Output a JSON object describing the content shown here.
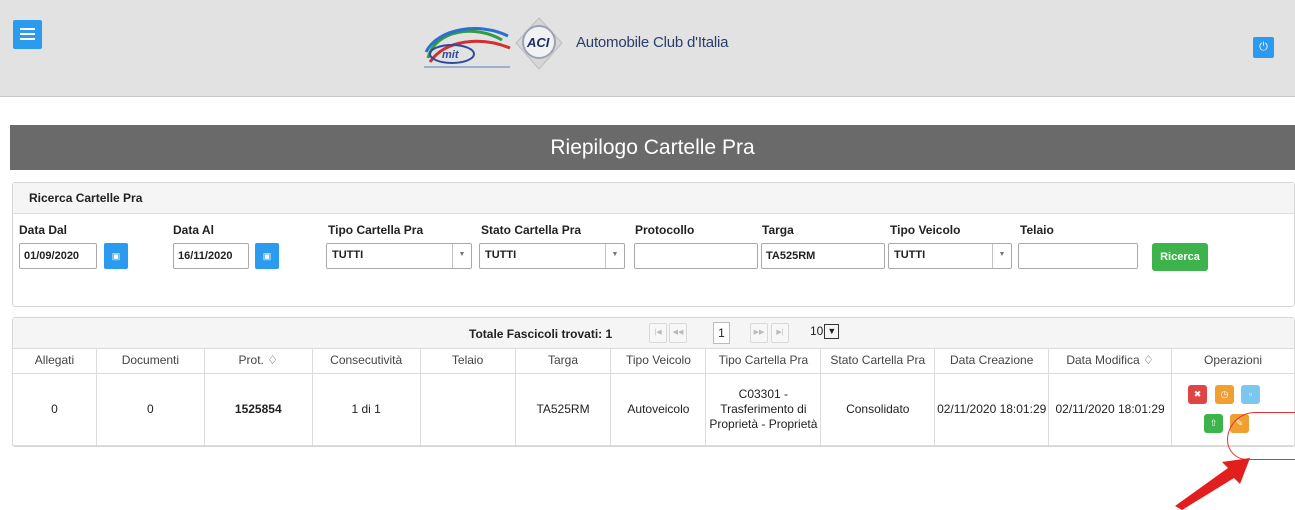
{
  "header": {
    "title": "Automobile Club d'Italia",
    "menu_icon": "hamburger-menu-icon",
    "power_icon": "power-icon",
    "mit_logo": "mit-logo",
    "aci_logo": "aci-logo",
    "brand_color": "#2b9bf0"
  },
  "page": {
    "title": "Riepilogo Cartelle Pra"
  },
  "search": {
    "heading": "Ricerca Cartelle Pra",
    "data_dal_label": "Data Dal",
    "data_dal_value": "01/09/2020",
    "data_al_label": "Data Al",
    "data_al_value": "16/11/2020",
    "tipo_cartella_label": "Tipo Cartella Pra",
    "tipo_cartella_value": "TUTTI",
    "stato_cartella_label": "Stato Cartella Pra",
    "stato_cartella_value": "TUTTI",
    "protocollo_label": "Protocollo",
    "protocollo_value": "",
    "targa_label": "Targa",
    "targa_value": "TA525RM",
    "tipo_veicolo_label": "Tipo Veicolo",
    "tipo_veicolo_value": "TUTTI",
    "telaio_label": "Telaio",
    "telaio_value": "",
    "ricerca_label": "Ricerca",
    "ricerca_color": "#3cb44b"
  },
  "results": {
    "total_label": "Totale Fascicoli trovati: 1",
    "current_page": "1",
    "per_page": "10",
    "columns": [
      "Allegati",
      "Documenti",
      "Prot. ♢",
      "Consecutività",
      "Telaio",
      "Targa",
      "Tipo Veicolo",
      "Tipo Cartella Pra",
      "Stato Cartella Pra",
      "Data Creazione",
      "Data Modifica ♢",
      "Operazioni"
    ],
    "rows": [
      {
        "allegati": "0",
        "documenti": "0",
        "prot": "1525854",
        "consecutivita": "1 di 1",
        "telaio": "",
        "targa": "TA525RM",
        "tipo_veicolo": "Autoveicolo",
        "tipo_cartella_1": "C03301 -",
        "tipo_cartella_2": "Trasferimento di",
        "tipo_cartella_3": "Proprietà - Proprietà",
        "stato": "Consolidato",
        "data_creazione": "02/11/2020 18:01:29",
        "data_modifica": "02/11/2020 18:01:29"
      }
    ]
  },
  "operations": {
    "delete_icon": "close-icon",
    "delete_color": "#e04545",
    "history_icon": "clock-icon",
    "history_color": "#f0a030",
    "view_icon": "document-icon",
    "view_color": "#7cc7ef",
    "upload_icon": "upload-icon",
    "upload_color": "#3cb44b",
    "edit_icon": "pencil-icon",
    "edit_color": "#f0a030"
  },
  "annotation": {
    "color": "#e53333"
  }
}
